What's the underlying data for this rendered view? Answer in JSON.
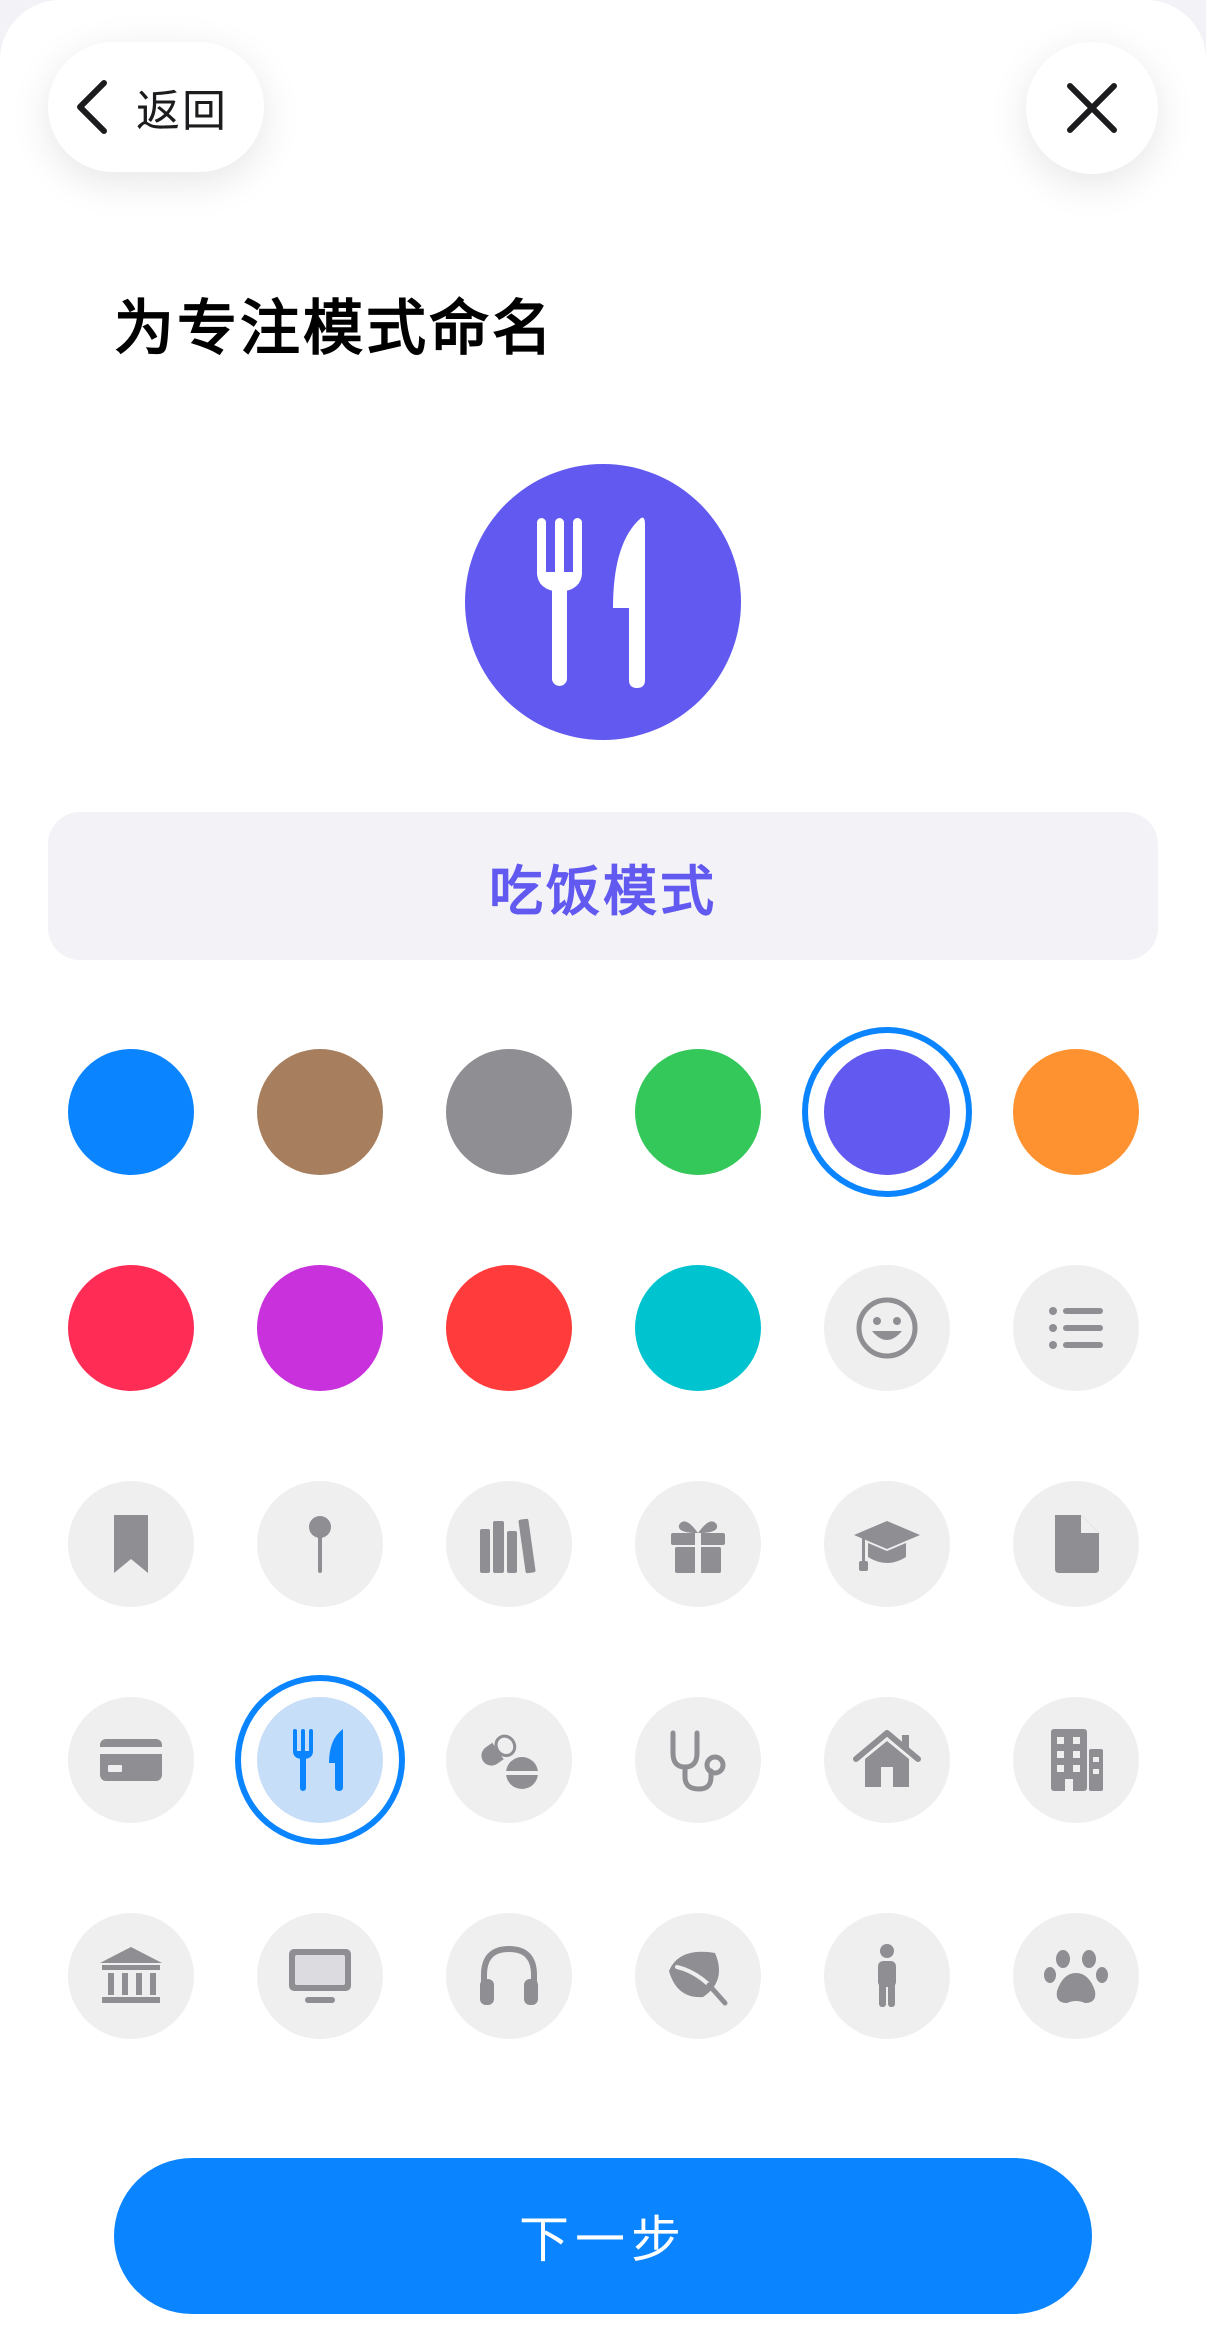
{
  "header": {
    "back_label": "返回",
    "title": "为专注模式命名"
  },
  "focus": {
    "name_value": "吃饭模式",
    "accent": "#6159f0",
    "preview_icon": "fork-knife-icon"
  },
  "colors": [
    {
      "name": "blue",
      "hex": "#0a84ff"
    },
    {
      "name": "brown",
      "hex": "#a77f5e"
    },
    {
      "name": "gray",
      "hex": "#8e8e93"
    },
    {
      "name": "green",
      "hex": "#34c759"
    },
    {
      "name": "indigo",
      "hex": "#6159f0",
      "selected": true
    },
    {
      "name": "orange",
      "hex": "#ff9230"
    },
    {
      "name": "pink",
      "hex": "#ff2d55"
    },
    {
      "name": "purple",
      "hex": "#c931dd"
    },
    {
      "name": "red",
      "hex": "#ff3b3b"
    },
    {
      "name": "teal",
      "hex": "#00c3d0"
    }
  ],
  "symbols": [
    "smiley-icon",
    "list-icon",
    "bookmark-icon",
    "pin-icon",
    "books-icon",
    "gift-icon",
    "graduation-cap-icon",
    "document-icon",
    "credit-card-icon",
    "fork-knife-icon",
    "pills-icon",
    "stethoscope-icon",
    "house-icon",
    "building-icon",
    "bank-icon",
    "monitor-icon",
    "headphones-icon",
    "leaf-icon",
    "person-icon",
    "paw-icon"
  ],
  "selected_symbol": "fork-knife-icon",
  "footer": {
    "next_label": "下一步"
  }
}
